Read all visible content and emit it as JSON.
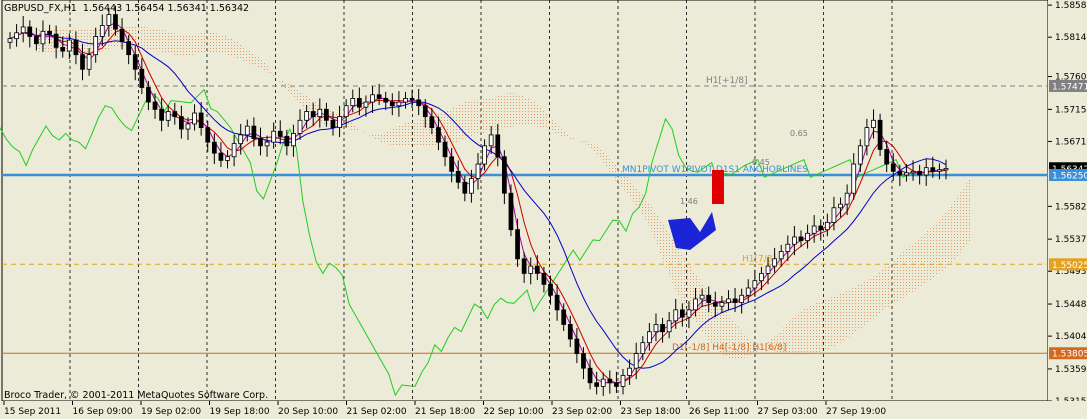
{
  "chart_data": {
    "type": "candlestick",
    "title": "GBPUSD_FX,H1",
    "ohlc_header": {
      "open": 1.56443,
      "high": 1.56454,
      "low": 1.56341,
      "close": 1.56342
    },
    "ohlc_text": "1.56443 1.56454 1.56341 1.56342",
    "footer": "Broco Trader, © 2001-2011 MetaQuotes Software Corp.",
    "ylim": [
      1.5315,
      1.5865
    ],
    "y_ticks": [
      1.5858,
      1.5814,
      1.576,
      1.5715,
      1.5671,
      1.5582,
      1.5537,
      1.5493,
      1.5448,
      1.5404,
      1.5359,
      1.5315
    ],
    "y_tick_labels": [
      "1.58580",
      "1.58140",
      "1.57600",
      "1.57150",
      "1.56710",
      "1.55820",
      "1.55370",
      "1.54930",
      "1.54480",
      "1.54040",
      "1.53590",
      "1.53150"
    ],
    "x_tick_labels": [
      "15 Sep 2011",
      "16 Sep 09:00",
      "19 Sep 02:00",
      "19 Sep 18:00",
      "20 Sep 10:00",
      "21 Sep 02:00",
      "21 Sep 18:00",
      "22 Sep 10:00",
      "23 Sep 02:00",
      "23 Sep 18:00",
      "26 Sep 11:00",
      "27 Sep 03:00",
      "27 Sep 19:00"
    ],
    "horizontal_levels": [
      {
        "value": 1.57471,
        "label": "1.57471",
        "annotation": "H1[+1/8]",
        "color": "#808080",
        "style": "dashed"
      },
      {
        "value": 1.56342,
        "label": "1.56342",
        "annotation": "",
        "color": "#404040",
        "style": "solid"
      },
      {
        "value": 1.5625,
        "label": "1.56250",
        "annotation": "MN1PIVOT W1PIVOT D1S1 ANCHORLINES",
        "color": "#3a8fd8",
        "style": "solid"
      },
      {
        "value": 1.55025,
        "label": "1.55025",
        "annotation": "H1[7/8]",
        "color": "#e5a020",
        "style": "dashed"
      },
      {
        "value": 1.53805,
        "label": "1.53805",
        "annotation": "D1[-1/8] H4[-1/8] H1[6/8]",
        "color": "#d2691e",
        "style": "solid"
      }
    ],
    "fib_labels": [
      "0.65",
      "0.45",
      "1.46"
    ],
    "series": [
      {
        "close": [
          1.5812,
          1.582,
          1.5828,
          1.5815,
          1.5805,
          1.5822,
          1.5818,
          1.58,
          1.5795,
          1.581,
          1.579,
          1.577,
          1.579,
          1.5815,
          1.583,
          1.5845,
          1.5825,
          1.5808,
          1.579,
          1.577,
          1.5745,
          1.5725,
          1.5715,
          1.57,
          1.5712,
          1.5705,
          1.5688,
          1.5695,
          1.571,
          1.569,
          1.567,
          1.5655,
          1.5645,
          1.565,
          1.5668,
          1.568,
          1.5692,
          1.5675,
          1.5665,
          1.567,
          1.5685,
          1.5678,
          1.5665,
          1.5682,
          1.57,
          1.5712,
          1.5705,
          1.5715,
          1.57,
          1.569,
          1.5705,
          1.572,
          1.573,
          1.5718,
          1.5725,
          1.5735,
          1.573,
          1.5725,
          1.572,
          1.5725,
          1.573,
          1.5728,
          1.572,
          1.5705,
          1.569,
          1.567,
          1.565,
          1.563,
          1.5615,
          1.56,
          1.562,
          1.564,
          1.5665,
          1.568,
          1.565,
          1.56,
          1.555,
          1.551,
          1.549,
          1.55,
          1.549,
          1.5475,
          1.546,
          1.544,
          1.542,
          1.54,
          1.538,
          1.536,
          1.534,
          1.5335,
          1.5345,
          1.534,
          1.5335,
          1.535,
          1.536,
          1.538,
          1.5395,
          1.541,
          1.542,
          1.541,
          1.5425,
          1.544,
          1.543,
          1.544,
          1.5455,
          1.546,
          1.545,
          1.5445,
          1.545,
          1.5455,
          1.545,
          1.546,
          1.547,
          1.548,
          1.549,
          1.55,
          1.551,
          1.552,
          1.553,
          1.554,
          1.5535,
          1.5545,
          1.5555,
          1.555,
          1.556,
          1.558,
          1.5585,
          1.56,
          1.564,
          1.5665,
          1.569,
          1.57,
          1.566,
          1.564,
          1.563,
          1.5625,
          1.5628,
          1.563,
          1.5625,
          1.5635,
          1.563,
          1.5632,
          1.5634
        ]
      },
      {
        "name": "",
        "color": "#22cc22"
      },
      {
        "name": "",
        "color": "#cc0000"
      },
      {
        "name": "",
        "color": "#0000cc"
      },
      {
        "name": "",
        "color": "#aa00aa"
      }
    ]
  }
}
